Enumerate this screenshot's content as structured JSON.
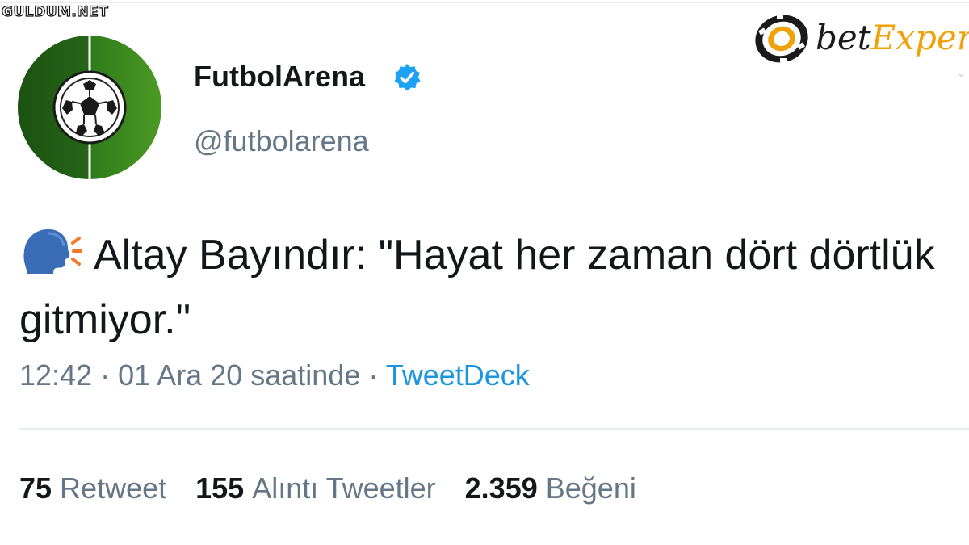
{
  "watermark": {
    "text": "GULDUM.NET"
  },
  "brand_logo": {
    "text_part1": "bet",
    "text_part2": "Exper"
  },
  "tweet": {
    "display_name": "FutbolArena",
    "verified": true,
    "handle": "@futbolarena",
    "avatar_icon": "soccer-ball-icon",
    "lead_icon": "speaking-head-icon",
    "text": "Altay Bayındır: \"Hayat her zaman dört dörtlük gitmiyor.\"",
    "time": "12:42",
    "separator": "·",
    "date": "01 Ara 20 saatinde",
    "source": "TweetDeck"
  },
  "stats": [
    {
      "count": "75",
      "label": "Retweet"
    },
    {
      "count": "155",
      "label": "Alıntı Tweetler"
    },
    {
      "count": "2.359",
      "label": "Beğeni"
    }
  ],
  "colors": {
    "text": "#14171a",
    "secondary": "#657786",
    "link": "#1b95e0",
    "verified": "#1da1f2",
    "divider": "#e6ecf0",
    "avatar_green": "#3f8b1f",
    "brand_orange": "#f0a20a"
  }
}
